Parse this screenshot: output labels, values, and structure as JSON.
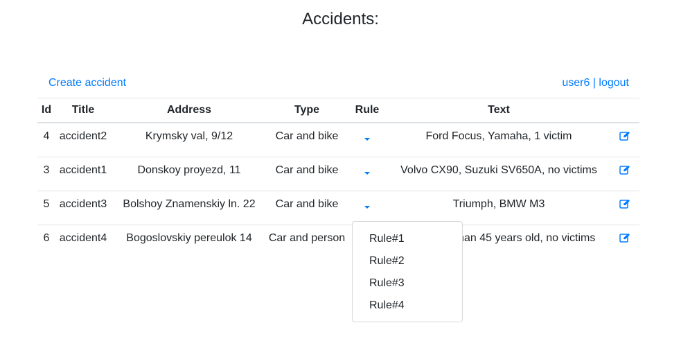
{
  "page": {
    "title": "Accidents:"
  },
  "topbar": {
    "create_label": "Create accident",
    "user": "user6",
    "separator": "|",
    "logout": "logout"
  },
  "table": {
    "headers": [
      "Id",
      "Title",
      "Address",
      "Type",
      "Rule",
      "Text"
    ],
    "rows": [
      {
        "id": "4",
        "title": "accident2",
        "address": "Krymsky val, 9/12",
        "type": "Car and bike",
        "text": "Ford Focus, Yamaha, 1 victim"
      },
      {
        "id": "3",
        "title": "accident1",
        "address": "Donskoy proyezd, 11",
        "type": "Car and bike",
        "text": "Volvo CX90, Suzuki SV650A, no victims"
      },
      {
        "id": "5",
        "title": "accident3",
        "address": "Bolshoy Znamenskiy ln. 22",
        "type": "Car and bike",
        "text": "Triumph, BMW M3"
      },
      {
        "id": "6",
        "title": "accident4",
        "address": "Bogoslovskiy pereulok 14",
        "type": "Car and person",
        "text": "man 45 years old, no victims"
      }
    ]
  },
  "rule_dropdown": {
    "options": [
      "Rule#1",
      "Rule#2",
      "Rule#3",
      "Rule#4"
    ]
  },
  "colors": {
    "link": "#007bff",
    "text": "#212529",
    "border": "#dee2e6"
  },
  "icons": {
    "rule_toggle": "caret-down-icon",
    "edit": "edit-icon"
  }
}
